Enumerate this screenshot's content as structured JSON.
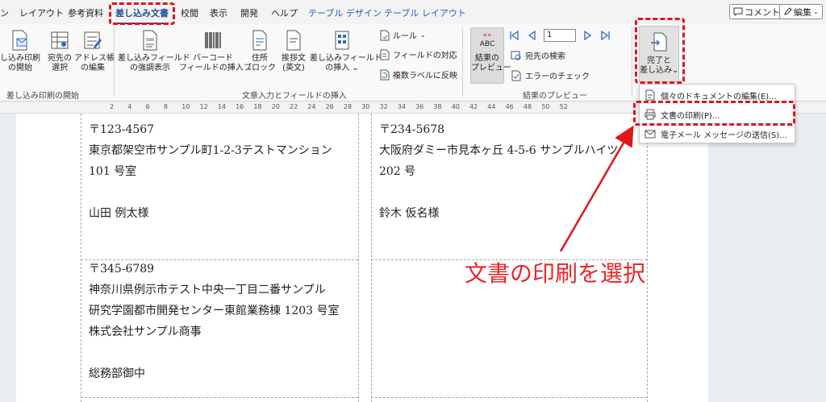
{
  "tabs": {
    "partial": "ン",
    "layout": "レイアウト",
    "references": "参考資料",
    "mailings": "差し込み文書",
    "review": "校閲",
    "view": "表示",
    "developer": "開発",
    "help": "ヘルプ",
    "table_design": "テーブル デザイン",
    "table_layout": "テーブル レイアウト"
  },
  "top_buttons": {
    "comment": "コメント",
    "edit": "編集"
  },
  "ribbon": {
    "start_mail_merge": [
      "し込み印刷",
      "の開始"
    ],
    "select_recipients": [
      "宛先の",
      "選択"
    ],
    "edit_recipients": [
      "アドレス帳",
      "の編集"
    ],
    "highlight_fields": [
      "差し込みフィールド",
      "の強調表示"
    ],
    "barcode_field": [
      "バーコード",
      "フィールドの挿入"
    ],
    "address_block": [
      "住所",
      "ブロック"
    ],
    "greeting_line": [
      "挨拶文",
      "(英文)"
    ],
    "insert_merge_field": [
      "差し込みフィールド",
      "の挿入"
    ],
    "rules": "ルール",
    "match_fields": "フィールドの対応",
    "update_labels": "複数ラベルに反映",
    "preview_results": [
      "結果の",
      "プレビュー"
    ],
    "preview_abc": "ABC",
    "record_number": "1",
    "find_recipient": "宛先の検索",
    "check_errors": "エラーのチェック",
    "finish_merge": [
      "完了と",
      "差し込み"
    ],
    "groups": {
      "start": "差し込み印刷の開始",
      "write_insert": "文章入力とフィールドの挿入",
      "preview": "結果のプレビュー"
    }
  },
  "ruler_ticks": [
    "2",
    "4",
    "6",
    "8",
    "10",
    "12",
    "14",
    "16",
    "18",
    "20",
    "22",
    "24",
    "26",
    "28",
    "30",
    "32",
    "34",
    "36",
    "38",
    "40",
    "42",
    "44",
    "46",
    "48",
    "50",
    "52"
  ],
  "labels": {
    "label1": {
      "zip": "〒123-4567",
      "addr1": "東京都架空市サンプル町1-2-3テストマンション",
      "addr2": "101 号室",
      "name": "山田 例太様"
    },
    "label2": {
      "zip": "〒234-5678",
      "addr1": "大阪府ダミー市見本ヶ丘 4-5-6 サンプルハイツ",
      "addr2": "202 号",
      "name": "鈴木 仮名様"
    },
    "label3": {
      "zip": "〒345-6789",
      "addr1": "神奈川県例示市テスト中央一丁目二番サンプル",
      "addr2": "研究学園都市開発センター東館業務棟 1203 号室",
      "company": "株式会社サンプル商事",
      "name": "総務部御中"
    }
  },
  "dropdown": {
    "edit_individual": "個々のドキュメントの編集(E)...",
    "print_documents": "文書の印刷(P)...",
    "send_email": "電子メール メッセージの送信(S)..."
  },
  "annotation": {
    "callout": "文書の印刷を選択",
    "color": "#e0161b"
  }
}
